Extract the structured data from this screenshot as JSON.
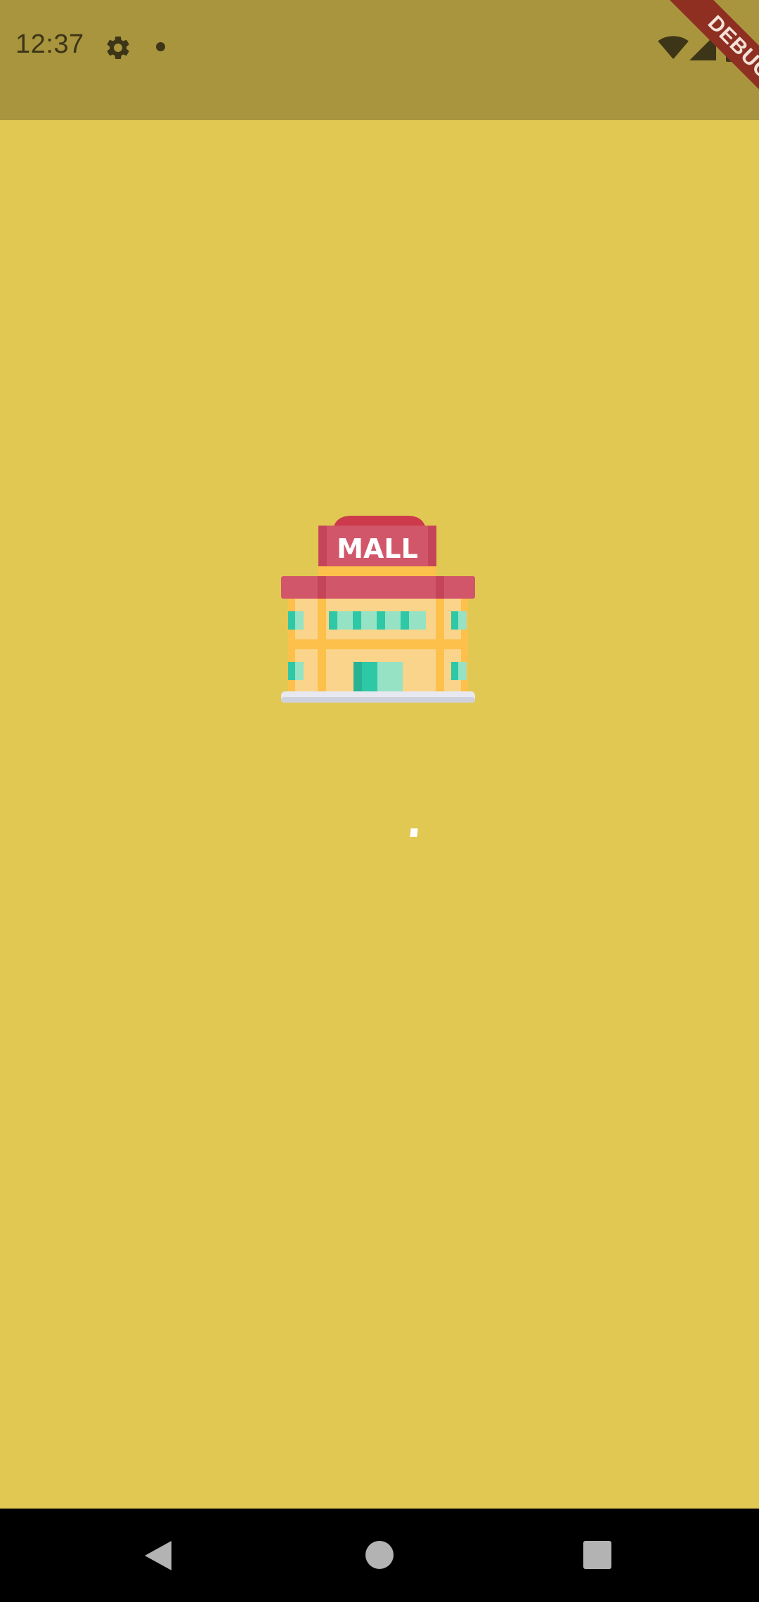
{
  "status_bar": {
    "time": "12:37",
    "icons": [
      "gear-icon",
      "notification-dot-icon",
      "wifi-icon",
      "cell-signal-icon",
      "battery-icon"
    ]
  },
  "debug_banner": {
    "label": "DEBUG"
  },
  "splash": {
    "logo_text": "MALL",
    "background_color": "#e1c853"
  },
  "nav_bar": {
    "buttons": [
      "back-icon",
      "home-icon",
      "recents-icon"
    ]
  },
  "colors": {
    "status_bar": "#a8953e",
    "background": "#e1c853",
    "debug_ribbon": "#8e2f22",
    "nav_bar": "#000000",
    "mall_sign": "#d15669",
    "mall_building": "#f9d48a",
    "mall_windows": "#2ec8a6"
  }
}
